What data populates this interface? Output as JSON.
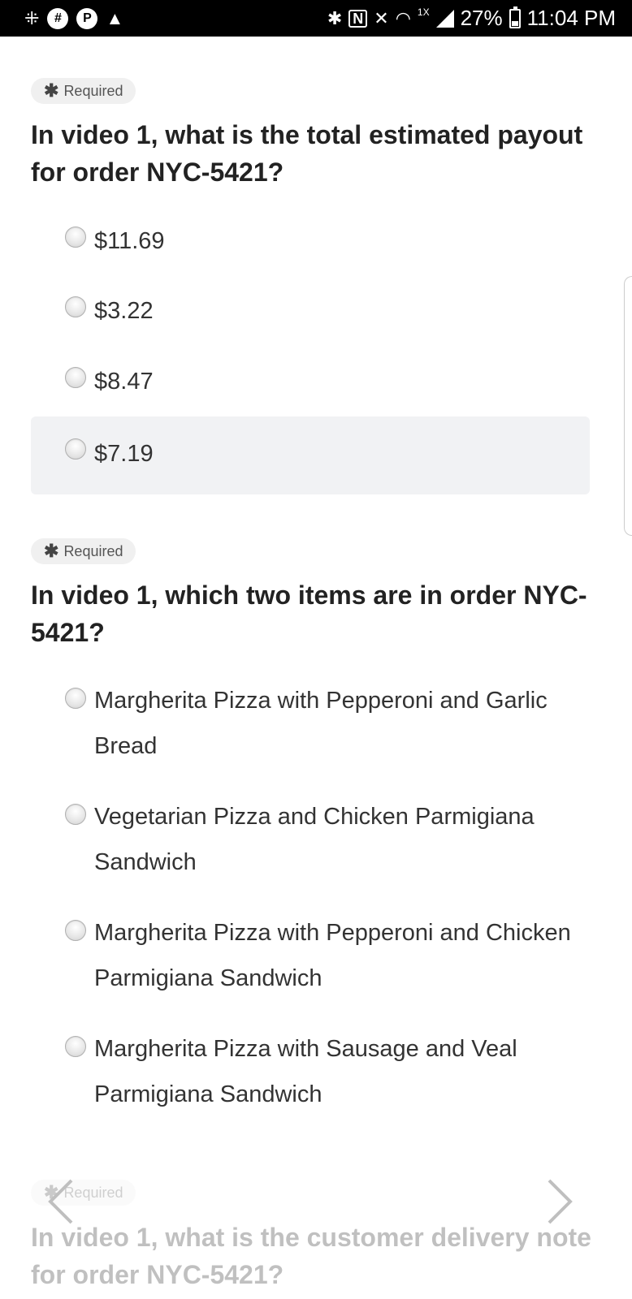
{
  "status_bar": {
    "battery": "27%",
    "time": "11:04 PM",
    "network_speed": "1X"
  },
  "questions": [
    {
      "required": "Required",
      "title": "In video 1, what is the total estimated payout for order NYC-5421?",
      "options": [
        {
          "label": "$11.69"
        },
        {
          "label": "$3.22"
        },
        {
          "label": "$8.47"
        },
        {
          "label": "$7.19"
        }
      ]
    },
    {
      "required": "Required",
      "title": "In video 1, which two items are in order NYC-5421?",
      "options": [
        {
          "label": "Margherita Pizza with Pepperoni and Garlic Bread"
        },
        {
          "label": "Vegetarian Pizza and Chicken Parmigiana Sandwich"
        },
        {
          "label": "Margherita Pizza with Pepperoni and Chicken Parmigiana Sandwich"
        },
        {
          "label": "Margherita Pizza with Sausage and Veal Parmigiana Sandwich"
        }
      ]
    },
    {
      "required": "Required",
      "title": "In video 1, what is the customer delivery note for order NYC-5421?"
    }
  ]
}
